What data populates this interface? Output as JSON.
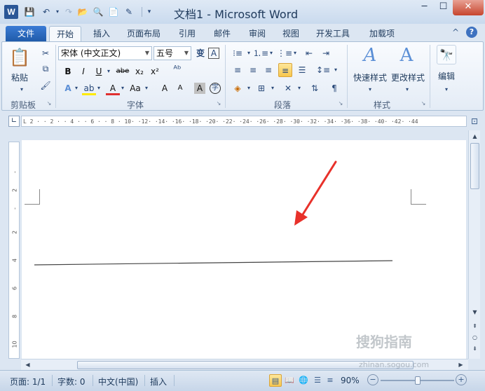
{
  "window": {
    "app_icon": "W",
    "title": "文档1 - Microsoft Word",
    "min": "─",
    "max": "☐",
    "close": "✕"
  },
  "qat": [
    "save-icon",
    "undo-icon",
    "redo-icon",
    "open-icon",
    "print-preview-icon",
    "new-icon",
    "edit-icon"
  ],
  "tabs": [
    {
      "label": "文件",
      "active": false,
      "file": true
    },
    {
      "label": "开始",
      "active": true
    },
    {
      "label": "插入"
    },
    {
      "label": "页面布局"
    },
    {
      "label": "引用"
    },
    {
      "label": "邮件"
    },
    {
      "label": "审阅"
    },
    {
      "label": "视图"
    },
    {
      "label": "开发工具"
    },
    {
      "label": "加载项"
    }
  ],
  "ribbon": {
    "clipboard": {
      "label": "剪贴板",
      "paste": "粘贴"
    },
    "font": {
      "label": "字体",
      "font_name": "宋体 (中文正文)",
      "font_size": "五号",
      "bold": "B",
      "italic": "I",
      "underline": "U",
      "strike": "abe",
      "subscript": "x₂",
      "superscript": "x²",
      "font_color_letter": "A",
      "change_case": "Aa",
      "grow": "A",
      "shrink": "A",
      "phonetic": "变",
      "border": "A",
      "char_shading": "A",
      "enclose": "字"
    },
    "paragraph": {
      "label": "段落"
    },
    "styles": {
      "label": "样式",
      "quick_styles": "快速样式",
      "change_styles": "更改样式"
    },
    "editing": {
      "label": "编辑"
    }
  },
  "ruler": {
    "h_ticks": "L 2 · · 2 · · 4 · · 6 · · 8 · 10· ·12· ·14· ·16· ·18· ·20· ·22· ·24· ·26· ·28· ·30· ·32· ·34· ·36· ·38· ·40· ·42· ·44",
    "v_numbers": [
      "-",
      "2",
      "-",
      "2",
      "4",
      "6",
      "8",
      "10"
    ]
  },
  "status": {
    "page": "页面: 1/1",
    "words": "字数: 0",
    "language": "中文(中国)",
    "mode": "插入",
    "zoom": "90%",
    "zoom_level": 0.5
  },
  "watermark": {
    "text": "搜狗指南",
    "url": "zhinan.sogou.com"
  }
}
